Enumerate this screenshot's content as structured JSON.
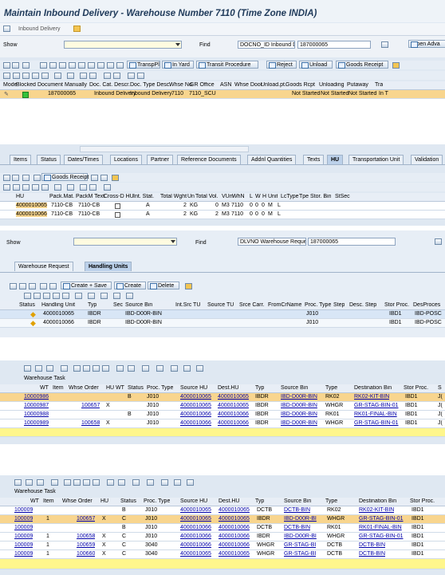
{
  "panel1": {
    "title": "Maintain Inbound Delivery - Warehouse Number 7110 (Time Zone INDIA)",
    "breadcrumb": "Inbound Delivery",
    "show_label": "Show",
    "find_label": "Find",
    "find_type": "DOCNO_ID Inbound Deliv.",
    "find_value": "187000065",
    "open_adv": "Open Adva",
    "toolbar": [
      "TranspPl",
      "In Yard",
      "Transit Procedure",
      "Reject",
      "Unload",
      "Goods Receipt"
    ],
    "doc_headers": [
      "Mode",
      "Blocked",
      "Document",
      "Manually",
      "Doc. Cat. Descr.",
      "Doc. Type Desc.",
      "Whse No.",
      "GR Office",
      "ASN",
      "Whse Door",
      "Unload.pt.",
      "Goods Rcpt",
      "Unloading",
      "Putaway",
      "Tra"
    ],
    "doc_row": {
      "document": "187000065",
      "cat": "Inbound Delivery",
      "type": "Inbound Delivery",
      "whse": "7110",
      "gr": "7110_SCU",
      "goods": "Not Started",
      "unloading": "Not Started",
      "putaway": "Not Started",
      "tra": "In T"
    },
    "tabs": [
      "Items",
      "Status",
      "Dates/Times",
      "Locations",
      "Partner",
      "Reference Documents",
      "Addnl Quantities",
      "Texts",
      "HU",
      "Transportation Unit",
      "Validation"
    ],
    "hu_toolbar": [
      "Goods Receipt"
    ],
    "hu_headers": [
      "HU",
      "Pack.Mat.",
      "PackM Text",
      "Cross-D HU",
      "Int. Stat.",
      "Total Wght",
      "Un",
      "Total Vol.",
      "VUn",
      "WhN",
      "L",
      "W",
      "H",
      "Unit",
      "LcType",
      "Tpe",
      "Stor. Bin",
      "StSec"
    ],
    "hu_rows": [
      [
        "4000010065",
        "7110-CB",
        "7110-CB",
        "A",
        "2",
        "KG",
        "0",
        "M3",
        "7110",
        "0",
        "0",
        "0",
        "M",
        "L"
      ],
      [
        "4000010066",
        "7110-CB",
        "7110-CB",
        "A",
        "2",
        "KG",
        "2",
        "M3",
        "7110",
        "0",
        "0",
        "0",
        "M",
        "L"
      ]
    ]
  },
  "panel2": {
    "show_label": "Show",
    "find_label": "Find",
    "find_type": "DLVNO Warehouse Reque.",
    "find_value": "187000065",
    "tabs": [
      "Warehouse Request",
      "Handling Units"
    ],
    "toolbar": [
      "Create + Save",
      "Create",
      "Delete"
    ],
    "headers": [
      "Status",
      "Handling Unit",
      "Typ",
      "Sec",
      "Source Bin",
      "Int.Src TU",
      "Source TU",
      "Srce Carr.",
      "FromCrName",
      "Proc. Type",
      "Step",
      "Desc. Step",
      "Stor Proc.",
      "DesProces"
    ],
    "rows": [
      [
        "4000010065",
        "IBDR",
        "IBD-D00R-BIN",
        "J010",
        "IBD1",
        "IBD-POSC"
      ],
      [
        "4000010066",
        "IBDR",
        "IBD-D00R-BIN",
        "J010",
        "IBD1",
        "IBD-POSC"
      ]
    ]
  },
  "panel3": {
    "title": "Warehouse Task",
    "headers": [
      "WT",
      "Item",
      "Whse Order",
      "HU WT",
      "Status",
      "Proc. Type",
      "Source HU",
      "Dest.HU",
      "Typ",
      "Source Bin",
      "Type",
      "Destination Bin",
      "Stor Proc.",
      "S"
    ],
    "rows": [
      [
        "10000986",
        "",
        "",
        "",
        "B",
        "J010",
        "4000010065",
        "4000010065",
        "IBDR",
        "IBD-D00R-BIN",
        "RK02",
        "RK02-KIT-BIN",
        "IBD1",
        "J("
      ],
      [
        "10000987",
        "",
        "100657",
        "X",
        "",
        "J010",
        "4000010065",
        "4000010065",
        "IBDR",
        "IBD-D00R-BIN",
        "WHGR",
        "GR-STAG-BIN-01",
        "IBD1",
        "J("
      ],
      [
        "10000988",
        "",
        "",
        "",
        "B",
        "J010",
        "4000010066",
        "4000010066",
        "IBDR",
        "IBD-D00R-BIN",
        "RK01",
        "RK01-FINAL-BIN",
        "IBD1",
        "J("
      ],
      [
        "10000989",
        "",
        "100658",
        "X",
        "",
        "J010",
        "4000010066",
        "4000010066",
        "IBDR",
        "IBD-D00R-BIN",
        "WHGR",
        "GR-STAG-BIN-01",
        "IBD1",
        "J("
      ]
    ]
  },
  "panel4": {
    "title": "Warehouse Task",
    "headers": [
      "WT",
      "Item",
      "Whse Order",
      "HU",
      "Status",
      "Proc. Type",
      "Source HU",
      "Dest.HU",
      "Typ",
      "Source Bin",
      "Type",
      "Destination Bin",
      "Stor Proc."
    ],
    "rows": [
      [
        "100009",
        "",
        "",
        "",
        "B",
        "J010",
        "4000010065",
        "4000010065",
        "DCTB",
        "DCTB-BIN",
        "RK02",
        "RK02-KIT-BIN",
        "IBD1"
      ],
      [
        "100009",
        "1",
        "100657",
        "X",
        "C",
        "J010",
        "4000010065",
        "4000010065",
        "IBDR",
        "IBD-D00R-BI",
        "WHGR",
        "GR-STAG-BIN-01",
        "IBD1"
      ],
      [
        "100009",
        "",
        "",
        "",
        "B",
        "J010",
        "4000010066",
        "4000010066",
        "DCTB",
        "DCTB-BIN",
        "RK01",
        "RK01-FINAL-BIN",
        "IBD1"
      ],
      [
        "100009",
        "1",
        "100658",
        "X",
        "C",
        "J010",
        "4000010066",
        "4000010066",
        "IBDR",
        "IBD-D00R-BI",
        "WHGR",
        "GR-STAG-BIN-01",
        "IBD1"
      ],
      [
        "100009",
        "1",
        "100659",
        "X",
        "C",
        "3040",
        "4000010066",
        "4000010066",
        "WHGR",
        "GR-STAG-BI",
        "DCTB",
        "DCTB-BIN",
        "IBD1"
      ],
      [
        "100009",
        "1",
        "100660",
        "X",
        "C",
        "3040",
        "4000010065",
        "4000010065",
        "WHGR",
        "GR-STAG-BI",
        "DCTB",
        "DCTB-BIN",
        "IBD1"
      ]
    ]
  }
}
